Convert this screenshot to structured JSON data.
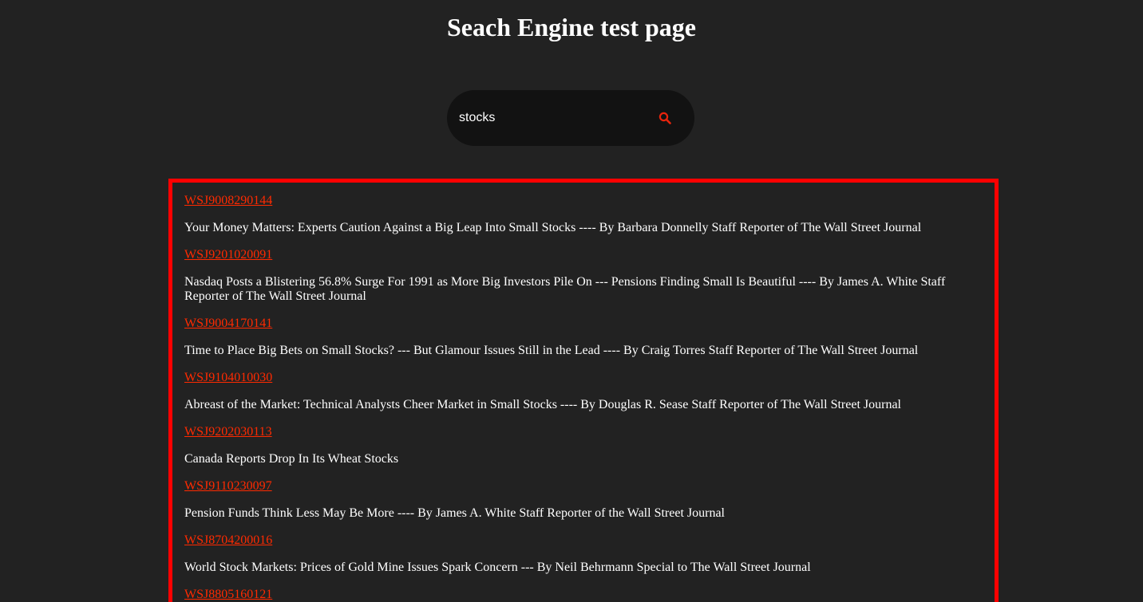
{
  "page": {
    "title": "Seach Engine test page"
  },
  "search": {
    "value": "stocks",
    "icon": "search-icon",
    "accent_color": "#e8240c"
  },
  "results": [
    {
      "id": "WSJ9008290144",
      "title": "Your Money Matters: Experts Caution Against a Big Leap Into Small Stocks ---- By Barbara Donnelly Staff Reporter of The Wall Street Journal"
    },
    {
      "id": "WSJ9201020091",
      "title": "Nasdaq Posts a Blistering 56.8% Surge For 1991 as More Big Investors Pile On --- Pensions Finding Small Is Beautiful ---- By James A. White Staff Reporter of The Wall Street Journal"
    },
    {
      "id": "WSJ9004170141",
      "title": "Time to Place Big Bets on Small Stocks? --- But Glamour Issues Still in the Lead ---- By Craig Torres Staff Reporter of The Wall Street Journal"
    },
    {
      "id": "WSJ9104010030",
      "title": "Abreast of the Market: Technical Analysts Cheer Market in Small Stocks ---- By Douglas R. Sease Staff Reporter of The Wall Street Journal"
    },
    {
      "id": "WSJ9202030113",
      "title": "Canada Reports Drop In Its Wheat Stocks"
    },
    {
      "id": "WSJ9110230097",
      "title": "Pension Funds Think Less May Be More ---- By James A. White Staff Reporter of the Wall Street Journal"
    },
    {
      "id": "WSJ8704200016",
      "title": "World Stock Markets: Prices of Gold Mine Issues Spark Concern --- By Neil Behrmann Special to The Wall Street Journal"
    },
    {
      "id": "WSJ8805160121",
      "title": ""
    }
  ],
  "colors": {
    "background": "#222222",
    "results_border": "#ff0000",
    "link": "#ff2a00",
    "text": "#ffffff",
    "search_bar": "#121212"
  }
}
